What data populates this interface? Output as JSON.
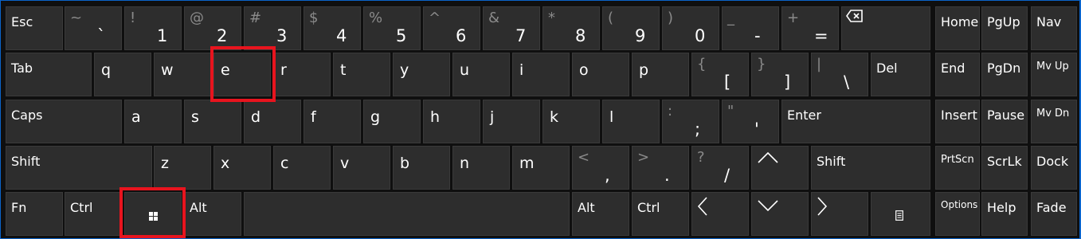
{
  "keys": {
    "esc": "Esc",
    "num1": {
      "shift": "~",
      "main": "`"
    },
    "n1": {
      "shift": "!",
      "main": "1"
    },
    "n2": {
      "shift": "@",
      "main": "2"
    },
    "n3": {
      "shift": "#",
      "main": "3"
    },
    "n4": {
      "shift": "$",
      "main": "4"
    },
    "n5": {
      "shift": "%",
      "main": "5"
    },
    "n6": {
      "shift": "^",
      "main": "6"
    },
    "n7": {
      "shift": "&",
      "main": "7"
    },
    "n8": {
      "shift": "*",
      "main": "8"
    },
    "n9": {
      "shift": "(",
      "main": "9"
    },
    "n0": {
      "shift": ")",
      "main": "0"
    },
    "minus": {
      "shift": "_",
      "main": "-"
    },
    "equals": {
      "shift": "+",
      "main": "="
    },
    "home": "Home",
    "pgup": "PgUp",
    "nav": "Nav",
    "tab": "Tab",
    "q": "q",
    "w": "w",
    "e": "e",
    "r": "r",
    "t": "t",
    "y": "y",
    "u": "u",
    "i": "i",
    "o": "o",
    "p": "p",
    "lbracket": {
      "shift": "{",
      "main": "["
    },
    "rbracket": {
      "shift": "}",
      "main": "]"
    },
    "backslash": {
      "shift": "|",
      "main": "\\"
    },
    "del": "Del",
    "end": "End",
    "pgdn": "PgDn",
    "mvup": "Mv Up",
    "caps": "Caps",
    "a": "a",
    "s": "s",
    "d": "d",
    "f": "f",
    "g": "g",
    "h": "h",
    "j": "j",
    "k": "k",
    "l": "l",
    "semicolon": {
      "shift": ":",
      "main": ";"
    },
    "quote": {
      "shift": "\"",
      "main": "'"
    },
    "enter": "Enter",
    "insert": "Insert",
    "pause": "Pause",
    "mvdn": "Mv Dn",
    "lshift": "Shift",
    "z": "z",
    "x": "x",
    "c": "c",
    "v": "v",
    "b": "b",
    "n": "n",
    "m": "m",
    "comma": {
      "shift": "<",
      "main": ","
    },
    "period": {
      "shift": ">",
      "main": "."
    },
    "slash": {
      "shift": "?",
      "main": "/"
    },
    "rshift": "Shift",
    "prtscn": "PrtScn",
    "scrlk": "ScrLk",
    "dock": "Dock",
    "fn": "Fn",
    "lctrl": "Ctrl",
    "lalt": "Alt",
    "ralt": "Alt",
    "rctrl": "Ctrl",
    "options": "Options",
    "help": "Help",
    "fade": "Fade"
  },
  "colors": {
    "background": "#0f0f0f",
    "key": "#2d2d2d",
    "highlight": "#e8141e",
    "frame": "#0a63c9"
  }
}
